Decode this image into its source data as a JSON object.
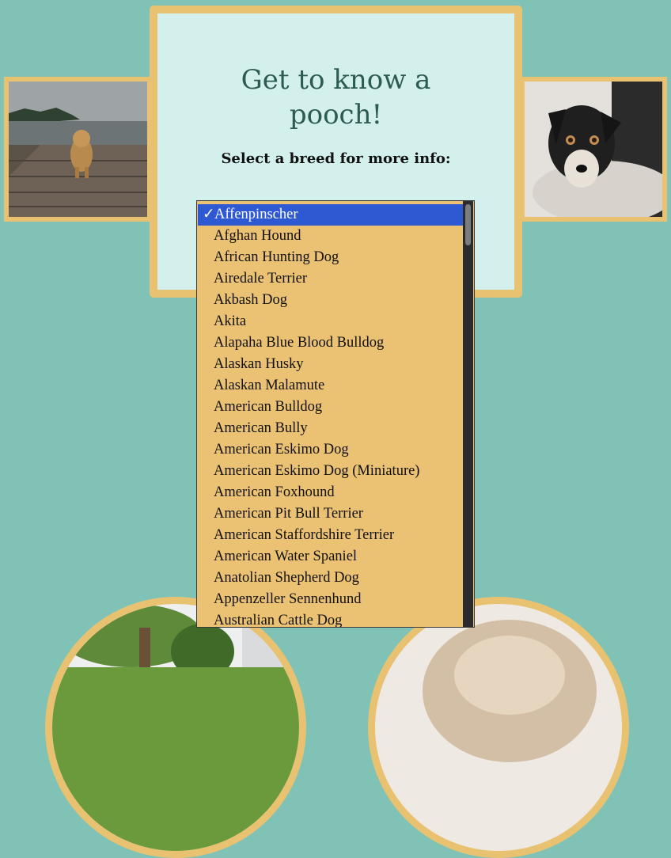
{
  "heading": "Get to know a pooch!",
  "subtitle": "Select a breed for more info:",
  "breed_select": {
    "selected_index": 0,
    "check_mark": "✓",
    "options": [
      "Affenpinscher",
      "Afghan Hound",
      "African Hunting Dog",
      "Airedale Terrier",
      "Akbash Dog",
      "Akita",
      "Alapaha Blue Blood Bulldog",
      "Alaskan Husky",
      "Alaskan Malamute",
      "American Bulldog",
      "American Bully",
      "American Eskimo Dog",
      "American Eskimo Dog (Miniature)",
      "American Foxhound",
      "American Pit Bull Terrier",
      "American Staffordshire Terrier",
      "American Water Spaniel",
      "Anatolian Shepherd Dog",
      "Appenzeller Sennenhund",
      "Australian Cattle Dog"
    ]
  },
  "colors": {
    "background": "#80c2b5",
    "frame": "#e9c271",
    "card": "#d3f0ec",
    "heading": "#2d5a55",
    "listbox": "#ebc173",
    "selected": "#2f59d3"
  }
}
